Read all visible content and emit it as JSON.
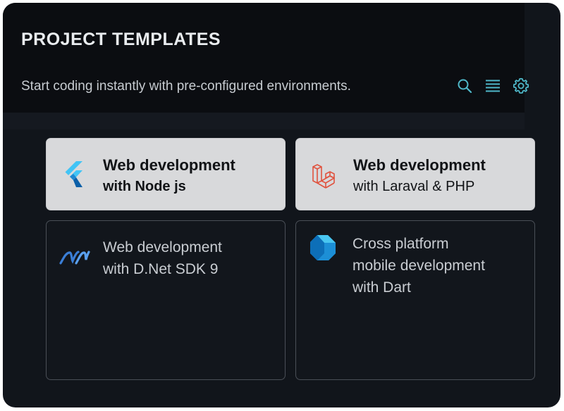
{
  "header": {
    "title": "PROJECT TEMPLATES",
    "subtitle": "Start coding instantly with pre-configured environments."
  },
  "toolbar": {
    "search_icon": "search-icon",
    "list_icon": "list-icon",
    "settings_icon": "gear-icon",
    "accent_color": "#4fb8c9"
  },
  "templates": [
    {
      "line1": "Web development",
      "line2": "with Node js",
      "icon": "flutter-icon",
      "style": "light"
    },
    {
      "line1": "Web development",
      "line2": "with Laraval & PHP",
      "icon": "laravel-icon",
      "style": "light"
    },
    {
      "line1": "Web development",
      "line2": "with D.Net SDK 9",
      "icon": "dotnet-icon",
      "style": "dark"
    },
    {
      "line1": "Cross platform",
      "line2": "mobile development",
      "line3": "with Dart",
      "icon": "dart-icon",
      "style": "dark"
    }
  ],
  "colors": {
    "panel_bg": "#11151b",
    "header_bg": "#0b0d11",
    "light_card_bg": "#d8d9db",
    "dark_card_border": "#4a4f57",
    "flutter_blue": "#41c4f5",
    "laravel_red": "#e0533f",
    "dotnet_blue": "#3a7ed6",
    "dart_blue": "#1c8fd6"
  }
}
